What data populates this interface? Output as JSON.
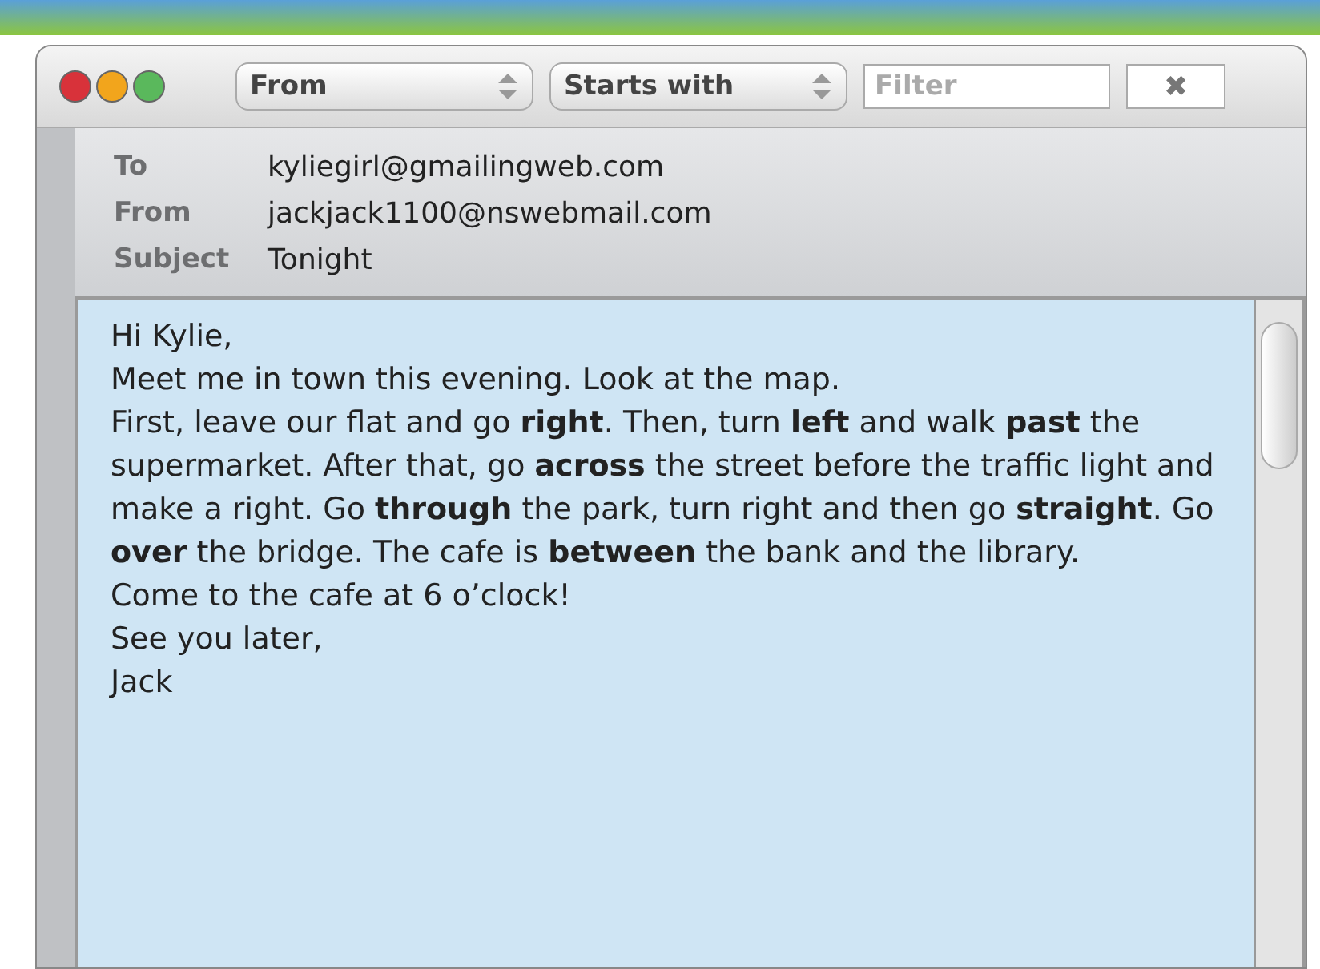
{
  "toolbar": {
    "field_dropdown": "From",
    "match_dropdown": "Starts with",
    "filter": {
      "placeholder": "Filter"
    },
    "clear_button": "✖"
  },
  "header": [
    {
      "label": "To",
      "value": "kyliegirl@gmailingweb.com"
    },
    {
      "label": "From",
      "value": "jackjack1100@nswebmail.com"
    },
    {
      "label": "Subject",
      "value": "Tonight"
    }
  ],
  "body": {
    "paragraphs": [
      "Hi Kylie,",
      "Meet me in town this evening. Look at the map.",
      "First, leave our flat and go **right**. Then, turn **left** and walk **past** the supermarket. After that, go **across** the street before the traffic light and make a right. Go **through** the park, turn right and then go **straight**. Go **over** the bridge. The cafe is **between** the bank and the library.",
      "Come to the cafe at 6 o’clock!",
      "See you later,",
      "Jack"
    ]
  }
}
